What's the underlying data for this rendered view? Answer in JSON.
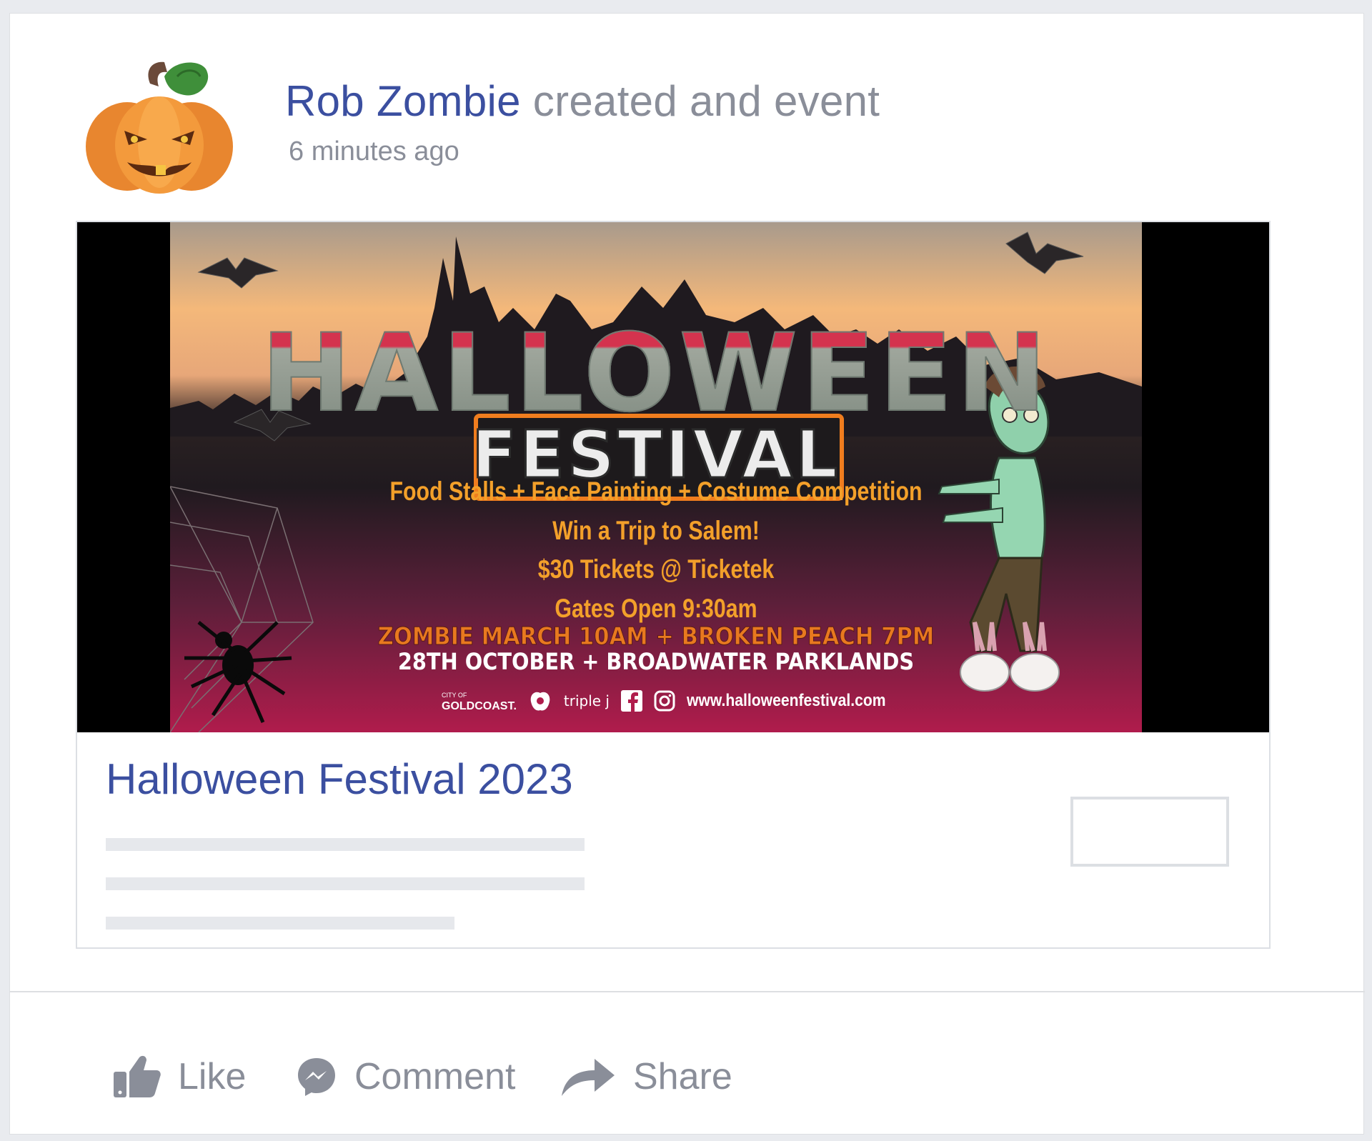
{
  "post": {
    "author": "Rob Zombie",
    "action_text": "created and event",
    "timestamp": "6 minutes ago",
    "avatar_icon": "pumpkin-icon"
  },
  "event": {
    "title": "Halloween Festival 2023",
    "banner": {
      "headline": "HALLOWEEN",
      "subheadline": "FESTIVAL",
      "lines": [
        "Food Stalls + Face Painting + Costume Competition",
        "Win a Trip to Salem!",
        "$30 Tickets @ Ticketek",
        "Gates Open 9:30am",
        "ZOMBIE MARCH 10AM + BROKEN PEACH 7PM",
        "28TH OCTOBER + BROADWATER PARKLANDS"
      ],
      "sponsor_city_small": "CITY OF",
      "sponsor_city": "GOLDCOAST.",
      "sponsor_radio": "triple j",
      "website": "www.halloweenfestival.com"
    }
  },
  "actions": {
    "like": "Like",
    "comment": "Comment",
    "share": "Share"
  },
  "colors": {
    "author": "#3b4fa0",
    "muted": "#8a8e99",
    "festival_orange": "#f07d1e",
    "banner_pink": "#b01c4c"
  }
}
